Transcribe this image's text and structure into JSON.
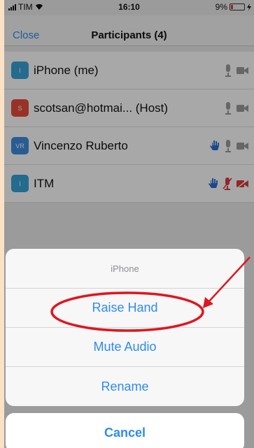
{
  "status_bar": {
    "carrier": "TIM",
    "time": "16:10",
    "battery": "9%"
  },
  "navbar": {
    "close_label": "Close",
    "title": "Participants (4)"
  },
  "participants": [
    {
      "initials": "I",
      "name": "iPhone (me)",
      "avatar_color": "#38a3d8",
      "hand_raised": false,
      "muted": false,
      "video_off": false
    },
    {
      "initials": "S",
      "name": "scotsan@hotmai... (Host)",
      "avatar_color": "#e74c3c",
      "hand_raised": false,
      "muted": false,
      "video_off": false
    },
    {
      "initials": "VR",
      "name": "Vincenzo Ruberto",
      "avatar_color": "#3d8ee0",
      "hand_raised": true,
      "muted": false,
      "video_off": false
    },
    {
      "initials": "I",
      "name": "ITM",
      "avatar_color": "#38a3d8",
      "hand_raised": true,
      "muted": true,
      "video_off": true
    }
  ],
  "action_sheet": {
    "title": "iPhone",
    "raise_hand": "Raise Hand",
    "mute_audio": "Mute Audio",
    "rename": "Rename",
    "cancel": "Cancel"
  },
  "colors": {
    "accent": "#2d8cf0",
    "annotation": "#e0161e",
    "muted_icon": "#e03a3a",
    "hand_icon": "#2b6fd6"
  }
}
